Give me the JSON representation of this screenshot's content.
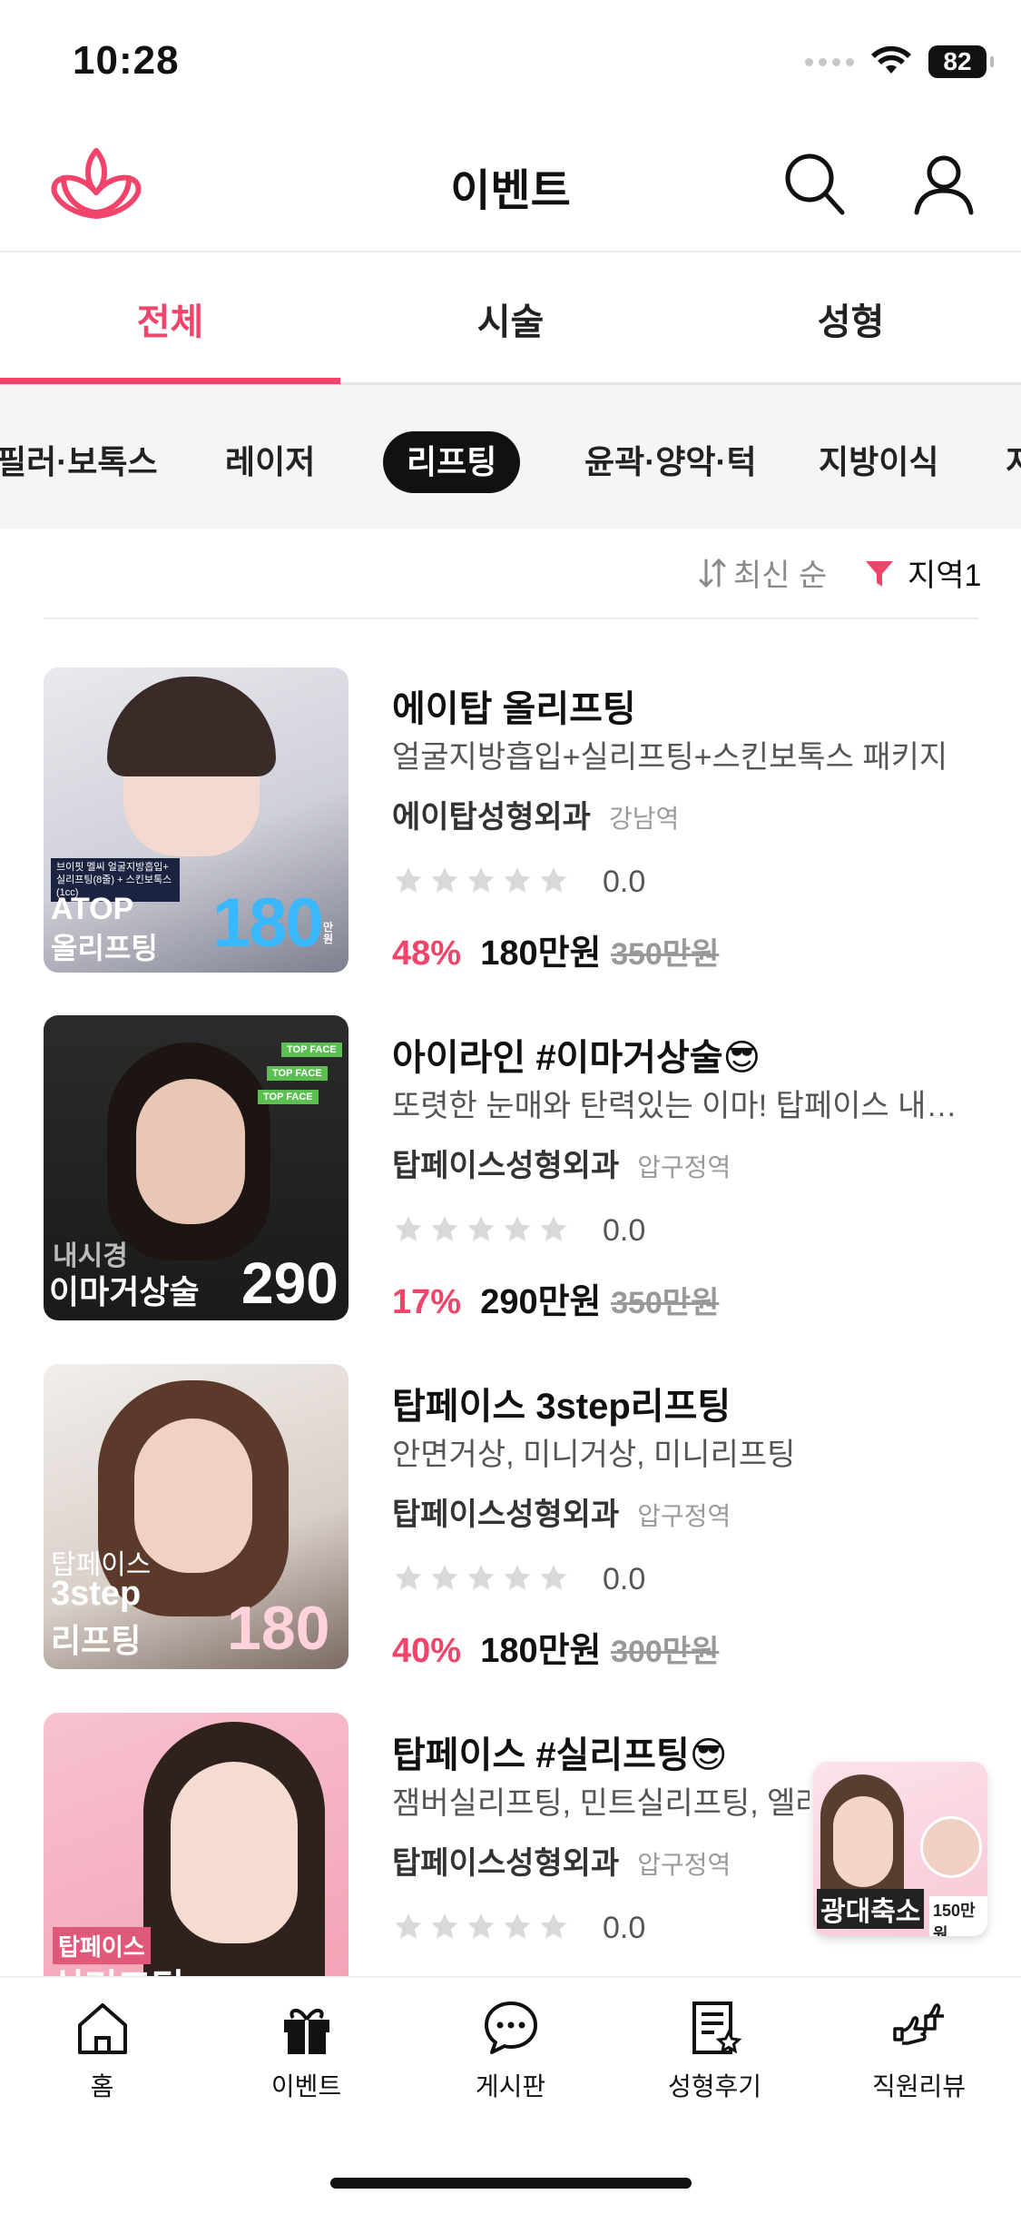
{
  "status": {
    "time": "10:28",
    "battery": "82"
  },
  "header": {
    "title": "이벤트"
  },
  "tabs": [
    {
      "label": "전체",
      "active": true
    },
    {
      "label": "시술",
      "active": false
    },
    {
      "label": "성형",
      "active": false
    }
  ],
  "chips": [
    {
      "label": "필러·보톡스",
      "active": false
    },
    {
      "label": "레이저",
      "active": false
    },
    {
      "label": "리프팅",
      "active": true
    },
    {
      "label": "윤곽·양악·턱",
      "active": false
    },
    {
      "label": "지방이식",
      "active": false
    },
    {
      "label": "지",
      "active": false
    }
  ],
  "sort": {
    "label": "최신 순",
    "region": "지역1"
  },
  "events": [
    {
      "title": "에이탑 올리프팅",
      "desc": "얼굴지방흡입+실리프팅+스킨보톡스 패키지",
      "clinic": "에이탑성형외과",
      "station": "강남역",
      "rating": "0.0",
      "discount": "48%",
      "price": "180만원",
      "old_price": "350만원",
      "thumb": {
        "line1": "ATOP",
        "line2": "올리프팅",
        "big": "180",
        "unit": "만원",
        "tag": "브이핏 멜씨 얼굴지방흡입+ 실리프팅(8줄) + 스킨보톡스(1cc)"
      }
    },
    {
      "title": "아이라인 #이마거상술😎",
      "desc": "또렷한 눈매와 탄력있는 이마! 탑페이스 내시경 이마거상술",
      "clinic": "탑페이스성형외과",
      "station": "압구정역",
      "rating": "0.0",
      "discount": "17%",
      "price": "290만원",
      "old_price": "350만원",
      "thumb": {
        "line1": "내시경",
        "line2": "이마거상술",
        "big": "290",
        "badge": "TOP FACE"
      }
    },
    {
      "title": "탑페이스 3step리프팅",
      "desc": "안면거상, 미니거상, 미니리프팅",
      "clinic": "탑페이스성형외과",
      "station": "압구정역",
      "rating": "0.0",
      "discount": "40%",
      "price": "180만원",
      "old_price": "300만원",
      "thumb": {
        "line1": "탑페이스",
        "line2": "3step",
        "line3": "리프팅",
        "big": "180"
      }
    },
    {
      "title": "탑페이스 #실리프팅😎",
      "desc": "잼버실리프팅, 민트실리프팅, 엘라스티 실리프팅",
      "clinic": "탑페이스성형외과",
      "station": "압구정역",
      "rating": "0.0",
      "thumb": {
        "line1": "탑페이스",
        "line2": "실리프팅"
      }
    }
  ],
  "float_banner": {
    "title": "광대축소",
    "price": "150만원"
  },
  "bottom_nav": [
    {
      "label": "홈",
      "icon": "home-icon"
    },
    {
      "label": "이벤트",
      "icon": "gift-icon"
    },
    {
      "label": "게시판",
      "icon": "chat-bubble-icon"
    },
    {
      "label": "성형후기",
      "icon": "review-document-icon"
    },
    {
      "label": "직원리뷰",
      "icon": "thumbs-icon"
    }
  ],
  "colors": {
    "accent": "#f0446b",
    "chip_active": "#111111",
    "chip_bar": "#f5f5f5"
  }
}
